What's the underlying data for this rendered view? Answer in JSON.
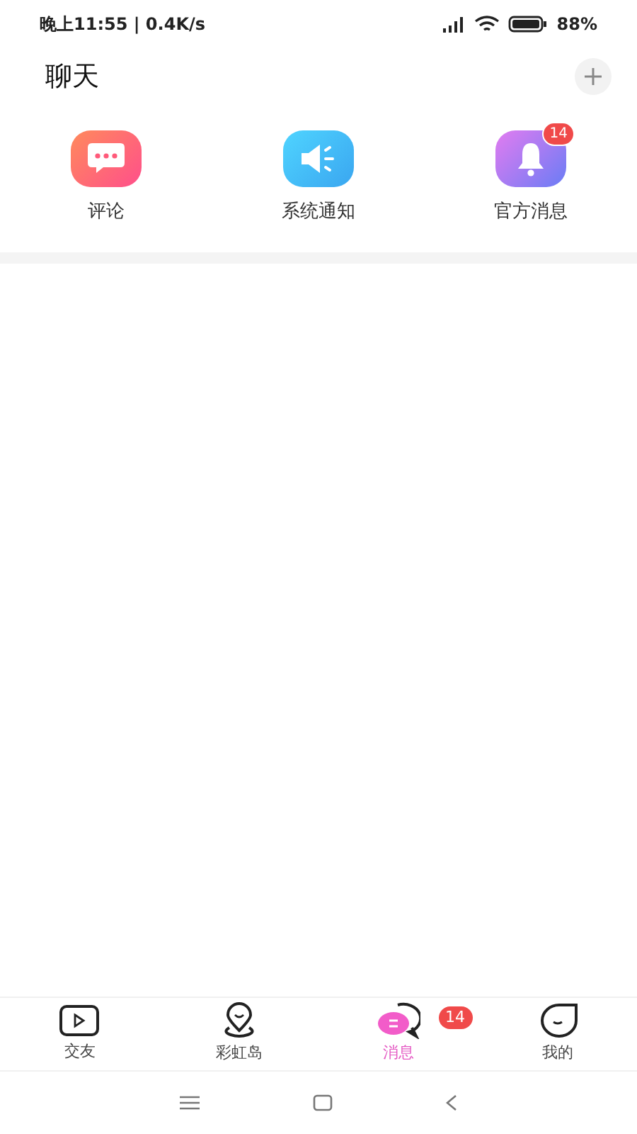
{
  "status_bar": {
    "time": "晚上11:55 | 0.4K/s",
    "battery": "88%"
  },
  "header": {
    "title": "聊天"
  },
  "shortcuts": [
    {
      "kind": "comment",
      "label": "评论"
    },
    {
      "kind": "system",
      "label": "系统通知"
    },
    {
      "kind": "official",
      "label": "官方消息",
      "badge": "14"
    }
  ],
  "tab_bar": [
    {
      "kind": "friends",
      "label": "交友",
      "selected": false
    },
    {
      "kind": "island",
      "label": "彩虹岛",
      "selected": false
    },
    {
      "kind": "messages",
      "label": "消息",
      "selected": true,
      "badge": "14"
    },
    {
      "kind": "me",
      "label": "我的",
      "selected": false
    }
  ]
}
